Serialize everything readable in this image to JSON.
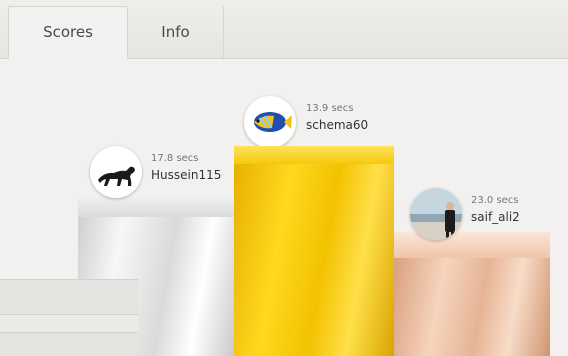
{
  "tabs": [
    {
      "label": "Scores",
      "active": true
    },
    {
      "label": "Info",
      "active": false
    }
  ],
  "podium": {
    "first": {
      "time": "13.9 secs",
      "name": "schema60",
      "avatar": "fish-icon",
      "color": "#f5c90b"
    },
    "second": {
      "time": "17.8 secs",
      "name": "Hussein115",
      "avatar": "panther-icon",
      "color": "#d9d9d9"
    },
    "third": {
      "time": "23.0 secs",
      "name": "saif_ali2",
      "avatar": "person-photo-icon",
      "color": "#e9b898"
    }
  }
}
